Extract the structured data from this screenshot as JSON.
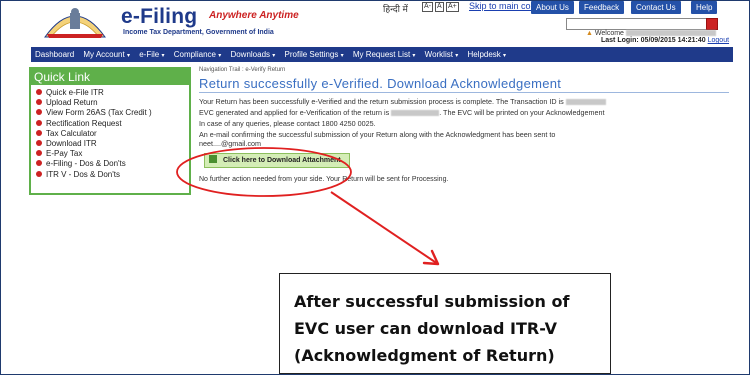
{
  "header": {
    "brand_title": "e-Filing",
    "brand_tagline": "Anywhere Anytime",
    "brand_subtitle": "Income Tax Department, Government of India",
    "lang_hindi": "हिन्दी में",
    "font_sizes": [
      "A-",
      "A",
      "A+"
    ],
    "skip_link": "Skip to main content",
    "top_links": [
      "About Us",
      "Feedback",
      "Contact Us",
      "Help"
    ],
    "search_placeholder": "",
    "welcome": "Welcome",
    "last_login_label": "Last Login: 05/09/2015 14:21:40",
    "logout": "Logout"
  },
  "nav": {
    "items": [
      "Dashboard",
      "My Account",
      "e-File",
      "Compliance",
      "Downloads",
      "Profile Settings",
      "My Request List",
      "Worklist",
      "Helpdesk"
    ]
  },
  "sidebar": {
    "title": "Quick Link",
    "items": [
      "Quick e-File ITR",
      "Upload Return",
      "View Form 26AS (Tax Credit )",
      "Rectification Request",
      "Tax Calculator",
      "Download ITR",
      "E-Pay Tax",
      "e-Filing - Dos & Don'ts",
      "ITR V - Dos & Don'ts"
    ]
  },
  "main": {
    "breadcrumb": "Navigation Trail : e-Verify Return",
    "title": "Return successfully e-Verified. Download Acknowledgement",
    "para1": "Your Return has been successfully e-Verified and the return submission process is complete. The Transaction ID is",
    "para2_a": "EVC generated and applied for e-Verification of the return is",
    "para2_b": ". The EVC will be printed on your Acknowledgement",
    "para3": "In case of any queries, please contact 1800 4250 0025.",
    "para4": "An e-mail confirming the successful submission of your Return along with the Acknowledgment has been sent to",
    "email": "neet....@gmail.com",
    "download_label": "Click here to Download Attachment.",
    "no_action": "No further action needed from your side. Your Return will be sent for Processing."
  },
  "callout": {
    "line1": "After successful submission of",
    "line2": "EVC user can download ITR-V",
    "line3": "(Acknowledgment of Return)"
  },
  "colors": {
    "brand_blue": "#1f3a8a",
    "sidebar_green": "#5fb04a",
    "annotation_red": "#e02020"
  }
}
